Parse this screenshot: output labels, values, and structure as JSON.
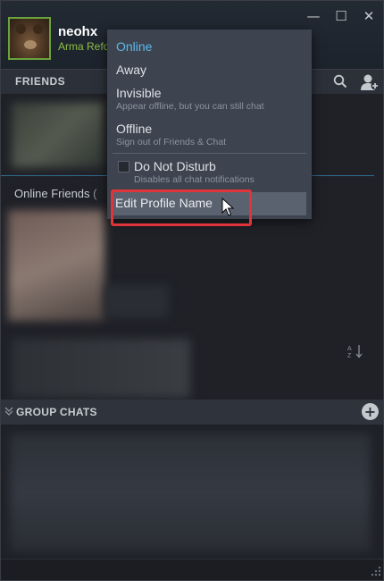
{
  "header": {
    "username": "neohx",
    "status_game": "Arma Refo",
    "chevron": "˅"
  },
  "window_controls": {
    "minimize": "—",
    "maximize": "☐",
    "close": "✕"
  },
  "friends_bar": {
    "title": "FRIENDS"
  },
  "online_section": {
    "label": "Online Friends",
    "count_prefix": "("
  },
  "group_chats": {
    "title": "GROUP CHATS"
  },
  "status_menu": {
    "items": [
      {
        "label": "Online",
        "sub": ""
      },
      {
        "label": "Away",
        "sub": ""
      },
      {
        "label": "Invisible",
        "sub": "Appear offline, but you can still chat"
      },
      {
        "label": "Offline",
        "sub": "Sign out of Friends & Chat"
      }
    ],
    "dnd": {
      "label": "Do Not Disturb",
      "sub": "Disables all chat notifications",
      "checked": false
    },
    "edit_profile": {
      "label": "Edit Profile Name"
    }
  },
  "colors": {
    "accent_online": "#5fb8ea",
    "game_status": "#8fbf46",
    "highlight": "#e0343b"
  }
}
